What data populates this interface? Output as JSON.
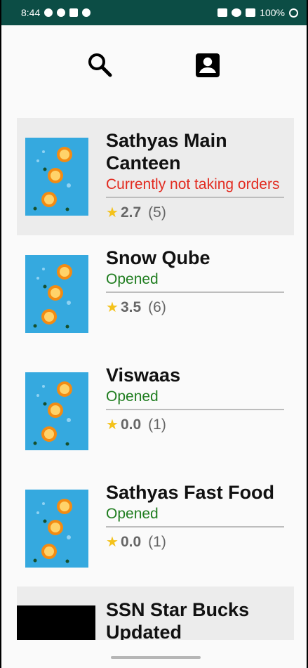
{
  "status_bar": {
    "time": "8:44",
    "battery": "100%",
    "icons_left": [
      "message-icon",
      "whatsapp-icon",
      "gmail-icon",
      "record-icon"
    ],
    "icons_right": [
      "cast-icon",
      "wifi-icon",
      "signal-icon",
      "battery-icon"
    ]
  },
  "top_actions": {
    "search_icon": "search-icon",
    "profile_icon": "account-box-icon"
  },
  "restaurants": [
    {
      "name": "Sathyas Main Canteen",
      "status": "Currently not taking orders",
      "status_color": "#e22b20",
      "rating": "2.7",
      "count": "(5)",
      "highlighted": true
    },
    {
      "name": "Snow Qube",
      "status": "Opened",
      "status_color": "#1f7d1f",
      "rating": "3.5",
      "count": "(6)",
      "highlighted": false
    },
    {
      "name": "Viswaas",
      "status": "Opened",
      "status_color": "#1f7d1f",
      "rating": "0.0",
      "count": "(1)",
      "highlighted": false
    },
    {
      "name": "Sathyas Fast Food",
      "status": "Opened",
      "status_color": "#1f7d1f",
      "rating": "0.0",
      "count": "(1)",
      "highlighted": false
    }
  ],
  "partial_restaurant": {
    "name": "SSN Star Bucks Updated"
  },
  "colors": {
    "status_bar": "#0c4d45",
    "background": "#fafafa",
    "highlight": "#ececec",
    "rating_star": "#f4c21b",
    "thumbnail_blue": "#35a9df"
  }
}
